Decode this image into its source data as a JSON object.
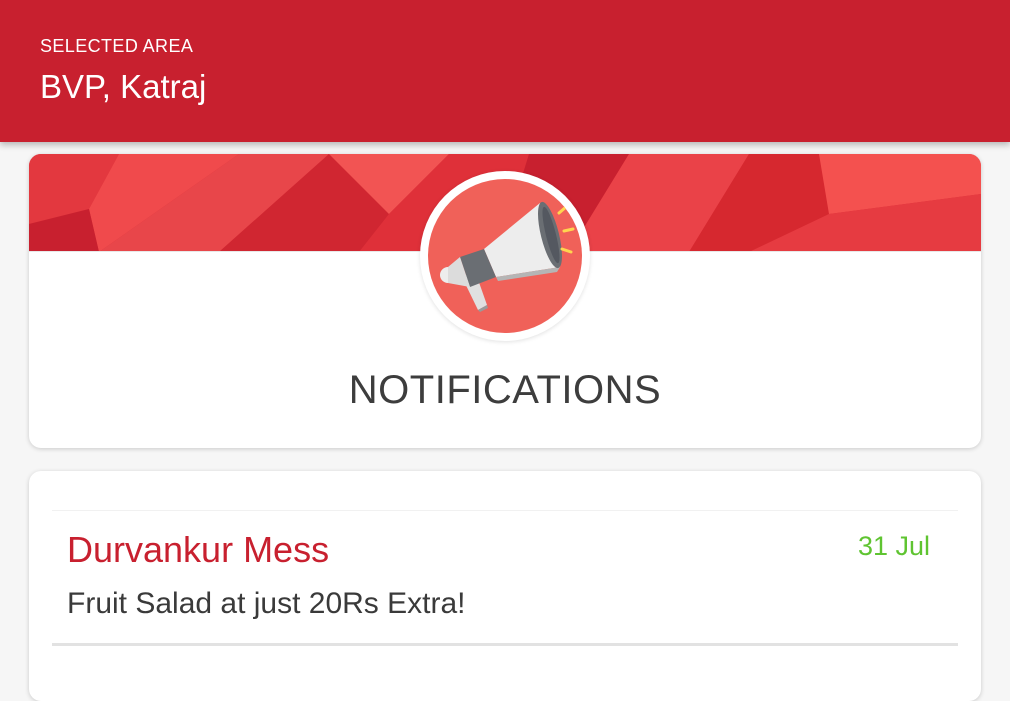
{
  "header": {
    "label": "SELECTED AREA",
    "area": "BVP, Katraj"
  },
  "banner": {
    "icon": "megaphone-icon",
    "title": "NOTIFICATIONS"
  },
  "notifications": [
    {
      "sender": "Durvankur Mess",
      "date": "31 Jul",
      "message": "Fruit Salad at just 20Rs Extra!"
    }
  ],
  "colors": {
    "primary": "#c8202f",
    "date": "#5fc431",
    "badge": "#f06159"
  }
}
